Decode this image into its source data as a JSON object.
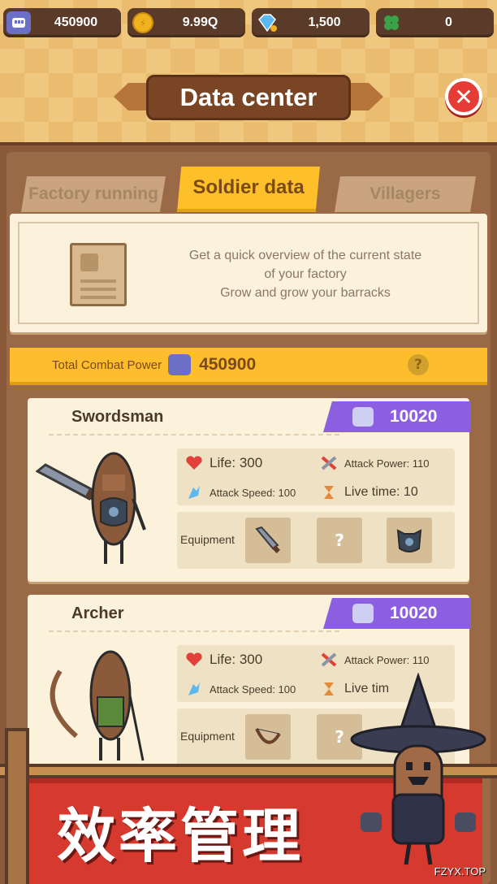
{
  "resources": [
    {
      "icon": "fist-icon",
      "value": "450900",
      "color": "#6d6fc6"
    },
    {
      "icon": "gold-coin-icon",
      "value": "9.99Q",
      "color": "#f0b21e"
    },
    {
      "icon": "diamond-icon",
      "value": "1,500",
      "color": "#5ab7f0"
    },
    {
      "icon": "clover-icon",
      "value": "0",
      "color": "#3aa24a"
    }
  ],
  "header": {
    "title": "Data center"
  },
  "tabs": [
    {
      "label": "Factory running"
    },
    {
      "label": "Soldier data",
      "active": true
    },
    {
      "label": "Villagers"
    }
  ],
  "info": {
    "line1": "Get a quick overview of the current state",
    "line2": "of your factory",
    "line3": "Grow and grow your barracks"
  },
  "total_power": {
    "label": "Total Combat Power",
    "value": "450900",
    "help": "?"
  },
  "soldiers": [
    {
      "name": "Swordsman",
      "power": "10020",
      "life": "Life: 300",
      "attack_power": "Attack Power: 110",
      "attack_speed": "Attack Speed: 100",
      "live_time": "Live time: 10",
      "equipment_label": "Equipment",
      "slots": [
        "sword-icon",
        "?",
        "shoulder-armor-icon"
      ]
    },
    {
      "name": "Archer",
      "power": "10020",
      "life": "Life: 300",
      "attack_power": "Attack Power: 110",
      "attack_speed": "Attack Speed: 100",
      "live_time": "Live tim",
      "equipment_label": "Equipment",
      "slots": [
        "bow-icon",
        "?"
      ]
    }
  ],
  "banner": {
    "text": "效率管理"
  },
  "watermark": "FZYX.TOP",
  "colors": {
    "accent": "#fdbd2c",
    "purple": "#8c5fe0",
    "red": "#d63a2f"
  }
}
